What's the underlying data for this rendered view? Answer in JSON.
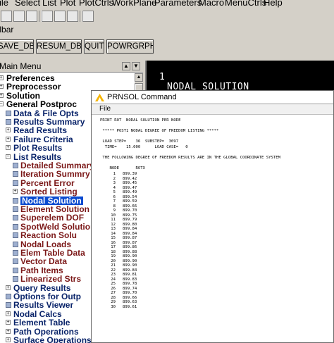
{
  "menubar": [
    "File",
    "Select",
    "List",
    "Plot",
    "PlotCtrls",
    "WorkPlane",
    "Parameters",
    "Macro",
    "MenuCtrls",
    "Help"
  ],
  "toolbar_label": "Toolbar",
  "toolbar_buttons": [
    "SAVE_DB",
    "RESUM_DB",
    "QUIT",
    "POWRGRPH"
  ],
  "main_menu": {
    "title": "Main Menu",
    "items": [
      {
        "label": "Preferences",
        "level": 0,
        "marker": "expand",
        "color": "black"
      },
      {
        "label": "Preprocessor",
        "level": 0,
        "marker": "expand",
        "color": "black"
      },
      {
        "label": "Solution",
        "level": 0,
        "marker": "expand",
        "color": "black"
      },
      {
        "label": "General Postproc",
        "level": 0,
        "marker": "collapse",
        "color": "black"
      },
      {
        "label": "Data & File Opts",
        "level": 1,
        "marker": "bullet",
        "color": "navy"
      },
      {
        "label": "Results Summary",
        "level": 1,
        "marker": "bullet",
        "color": "navy"
      },
      {
        "label": "Read Results",
        "level": 1,
        "marker": "expand",
        "color": "navy"
      },
      {
        "label": "Failure Criteria",
        "level": 1,
        "marker": "expand",
        "color": "navy"
      },
      {
        "label": "Plot Results",
        "level": 1,
        "marker": "expand",
        "color": "navy"
      },
      {
        "label": "List Results",
        "level": 1,
        "marker": "collapse",
        "color": "navy"
      },
      {
        "label": "Detailed Summary",
        "level": 2,
        "marker": "bullet",
        "color": "maroon"
      },
      {
        "label": "Iteration Summry",
        "level": 2,
        "marker": "bullet",
        "color": "maroon"
      },
      {
        "label": "Percent Error",
        "level": 2,
        "marker": "bullet",
        "color": "maroon"
      },
      {
        "label": "Sorted Listing",
        "level": 2,
        "marker": "expand",
        "color": "maroon"
      },
      {
        "label": "Nodal Solution",
        "level": 2,
        "marker": "bullet",
        "color": "selected"
      },
      {
        "label": "Element Solution",
        "level": 2,
        "marker": "bullet",
        "color": "maroon"
      },
      {
        "label": "Superelem DOF",
        "level": 2,
        "marker": "bullet",
        "color": "maroon"
      },
      {
        "label": "SpotWeld Solution",
        "level": 2,
        "marker": "bullet",
        "color": "maroon"
      },
      {
        "label": "Reaction Solu",
        "level": 2,
        "marker": "bullet",
        "color": "maroon"
      },
      {
        "label": "Nodal Loads",
        "level": 2,
        "marker": "bullet",
        "color": "maroon"
      },
      {
        "label": "Elem Table Data",
        "level": 2,
        "marker": "bullet",
        "color": "maroon"
      },
      {
        "label": "Vector Data",
        "level": 2,
        "marker": "bullet",
        "color": "maroon"
      },
      {
        "label": "Path Items",
        "level": 2,
        "marker": "bullet",
        "color": "maroon"
      },
      {
        "label": "Linearized Strs",
        "level": 2,
        "marker": "bullet",
        "color": "maroon"
      },
      {
        "label": "Query Results",
        "level": 1,
        "marker": "expand",
        "color": "navy"
      },
      {
        "label": "Options for Outp",
        "level": 1,
        "marker": "bullet",
        "color": "navy"
      },
      {
        "label": "Results Viewer",
        "level": 1,
        "marker": "bullet",
        "color": "navy"
      },
      {
        "label": "Nodal Calcs",
        "level": 1,
        "marker": "expand",
        "color": "navy"
      },
      {
        "label": "Element Table",
        "level": 1,
        "marker": "expand",
        "color": "navy"
      },
      {
        "label": "Path Operations",
        "level": 1,
        "marker": "expand",
        "color": "navy"
      },
      {
        "label": "Surface Operations",
        "level": 1,
        "marker": "expand",
        "color": "navy"
      }
    ]
  },
  "graphics": {
    "window_number": "1",
    "title": "NODAL SOLUTION"
  },
  "dialog": {
    "title": "PRNSOL  Command",
    "menu_file": "File",
    "header_lines": [
      "PRINT ROT  NODAL SOLUTION PER NODE",
      "",
      " ***** POST1 NODAL DEGREE OF FREEDOM LISTING *****",
      "",
      " LOAD STEP=    36  SUBSTEP=  3097",
      "  TIME=    15.000      LOAD CASE=   0",
      "",
      " THE FOLLOWING DEGREE OF FREEDOM RESULTS ARE IN THE GLOBAL COORDINATE SYSTEM",
      "",
      "    NODE       ROTX"
    ],
    "rows": [
      [
        "1",
        "899.39"
      ],
      [
        "2",
        "899.42"
      ],
      [
        "3",
        "899.45"
      ],
      [
        "4",
        "899.47"
      ],
      [
        "5",
        "899.49"
      ],
      [
        "6",
        "899.54"
      ],
      [
        "7",
        "899.59"
      ],
      [
        "8",
        "899.66"
      ],
      [
        "9",
        "899.70"
      ],
      [
        "10",
        "899.75"
      ],
      [
        "11",
        "899.79"
      ],
      [
        "12",
        "899.80"
      ],
      [
        "13",
        "899.84"
      ],
      [
        "14",
        "899.84"
      ],
      [
        "15",
        "899.87"
      ],
      [
        "16",
        "899.87"
      ],
      [
        "17",
        "899.86"
      ],
      [
        "18",
        "899.88"
      ],
      [
        "19",
        "899.90"
      ],
      [
        "20",
        "899.90"
      ],
      [
        "21",
        "899.90"
      ],
      [
        "22",
        "899.84"
      ],
      [
        "23",
        "899.81"
      ],
      [
        "24",
        "899.83"
      ],
      [
        "25",
        "899.78"
      ],
      [
        "26",
        "899.74"
      ],
      [
        "27",
        "899.70"
      ],
      [
        "28",
        "899.66"
      ],
      [
        "29",
        "899.63"
      ],
      [
        "30",
        "899.61"
      ]
    ]
  },
  "colors": {
    "window_bg": "#d4d0c8",
    "menu_navy": "#0a246a",
    "menu_maroon": "#7b1818",
    "selection": "#0a4bd0",
    "graphics_bg": "#000000"
  }
}
